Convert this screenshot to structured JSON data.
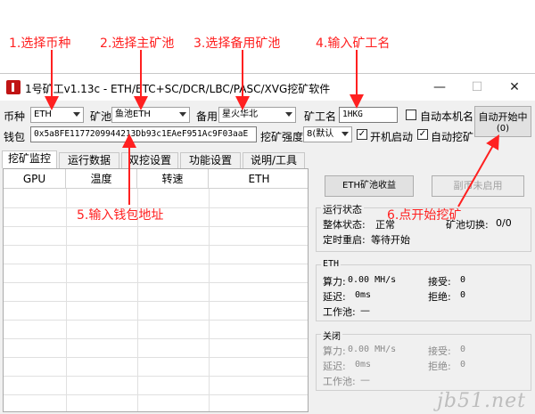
{
  "annotations": [
    "1.选择币种",
    "2.选择主矿池",
    "3.选择备用矿池",
    "4.输入矿工名",
    "5.输入钱包地址",
    "6.点开始挖矿"
  ],
  "accent_color": "#ff2020",
  "window": {
    "title": "1号矿工v1.13c - ETH/ETC+SC/DCR/LBC/PASC/XVG挖矿软件",
    "minimize": "—",
    "maximize": "☐",
    "close": "✕"
  },
  "form": {
    "coin_label": "币种",
    "coin_value": "ETH",
    "pool_label": "矿池",
    "pool_value": "鱼池ETH",
    "backup_label": "备用",
    "backup_value": "星火华北",
    "miner_label": "矿工名",
    "miner_value": "1HKG",
    "auto_name_label": "自动本机名",
    "wallet_label": "钱包",
    "wallet_value": "0x5a8FE1177209944213Db93c1EAeF951Ac9F03aaE",
    "intensity_label": "挖矿强度",
    "intensity_value": "8(默认",
    "boot_start_label": "开机启动",
    "auto_mine_label": "自动挖矿",
    "start_button_line1": "自动开始中",
    "start_button_line2": "(0)"
  },
  "tabs": [
    "挖矿监控",
    "运行数据",
    "双挖设置",
    "功能设置",
    "说明/工具"
  ],
  "grid": {
    "columns": [
      "GPU",
      "温度",
      "转速",
      "ETH"
    ]
  },
  "right": {
    "eth_pool_button": "ETH矿池收益",
    "coin_disabled_button": "副币未启用",
    "status": {
      "title": "运行状态",
      "overall_label": "整体状态:",
      "overall_value": "正常",
      "pool_switch_label": "矿池切换:",
      "pool_switch_value": "0/0",
      "timer_label": "定时重启:",
      "timer_value": "等待开始"
    },
    "eth": {
      "title": "ETH",
      "hashrate_label": "算力:",
      "hashrate_value": "0.00 MH/s",
      "accept_label": "接受:",
      "accept_value": "0",
      "latency_label": "延迟:",
      "latency_value": "0ms",
      "reject_label": "拒绝:",
      "reject_value": "0",
      "worker_label": "工作池:",
      "worker_value": "—"
    },
    "off": {
      "title": "关闭",
      "hashrate_label": "算力:",
      "hashrate_value": "0.00 MH/s",
      "accept_label": "接受:",
      "accept_value": "0",
      "latency_label": "延迟:",
      "latency_value": "0ms",
      "reject_label": "拒绝:",
      "reject_value": "0",
      "worker_label": "工作池:",
      "worker_value": "—"
    }
  },
  "watermark": "jb51.net"
}
